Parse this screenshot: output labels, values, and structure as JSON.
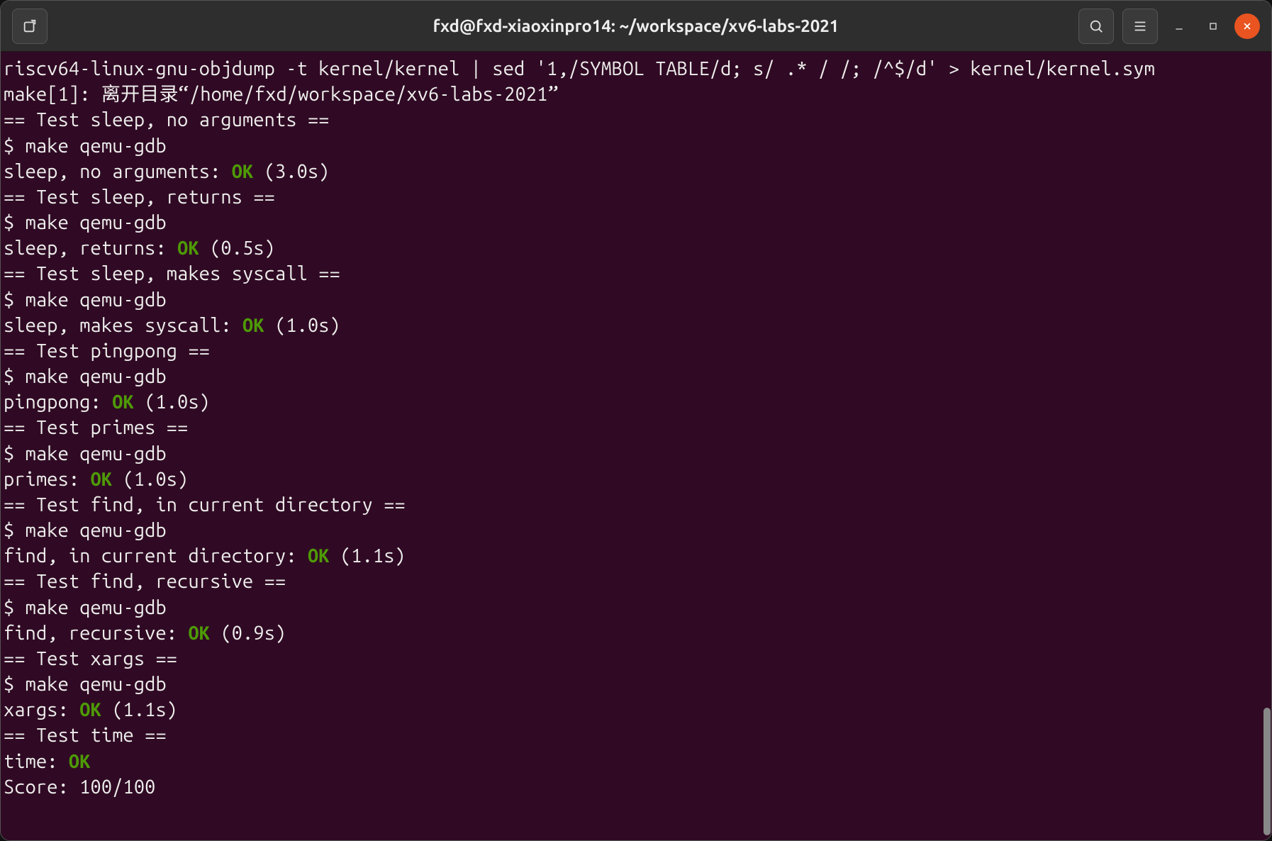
{
  "window": {
    "title": "fxd@fxd-xiaoxinpro14: ~/workspace/xv6-labs-2021"
  },
  "terminal": {
    "lines": [
      {
        "t": "riscv64-linux-gnu-objdump -t kernel/kernel | sed '1,/SYMBOL TABLE/d; s/ .* / /; /^$/d' > kernel/kernel.sym"
      },
      {
        "t": "make[1]: 离开目录“/home/fxd/workspace/xv6-labs-2021”"
      },
      {
        "t": "== Test sleep, no arguments =="
      },
      {
        "t": "$ make qemu-gdb"
      },
      {
        "pre": "sleep, no arguments: ",
        "ok": "OK",
        "post": " (3.0s)"
      },
      {
        "t": "== Test sleep, returns =="
      },
      {
        "t": "$ make qemu-gdb"
      },
      {
        "pre": "sleep, returns: ",
        "ok": "OK",
        "post": " (0.5s)"
      },
      {
        "t": "== Test sleep, makes syscall =="
      },
      {
        "t": "$ make qemu-gdb"
      },
      {
        "pre": "sleep, makes syscall: ",
        "ok": "OK",
        "post": " (1.0s)"
      },
      {
        "t": "== Test pingpong =="
      },
      {
        "t": "$ make qemu-gdb"
      },
      {
        "pre": "pingpong: ",
        "ok": "OK",
        "post": " (1.0s)"
      },
      {
        "t": "== Test primes =="
      },
      {
        "t": "$ make qemu-gdb"
      },
      {
        "pre": "primes: ",
        "ok": "OK",
        "post": " (1.0s)"
      },
      {
        "t": "== Test find, in current directory =="
      },
      {
        "t": "$ make qemu-gdb"
      },
      {
        "pre": "find, in current directory: ",
        "ok": "OK",
        "post": " (1.1s)"
      },
      {
        "t": "== Test find, recursive =="
      },
      {
        "t": "$ make qemu-gdb"
      },
      {
        "pre": "find, recursive: ",
        "ok": "OK",
        "post": " (0.9s)"
      },
      {
        "t": "== Test xargs =="
      },
      {
        "t": "$ make qemu-gdb"
      },
      {
        "pre": "xargs: ",
        "ok": "OK",
        "post": " (1.1s)"
      },
      {
        "t": "== Test time =="
      },
      {
        "pre": "time: ",
        "ok": "OK",
        "post": ""
      },
      {
        "t": "Score: 100/100"
      }
    ]
  }
}
